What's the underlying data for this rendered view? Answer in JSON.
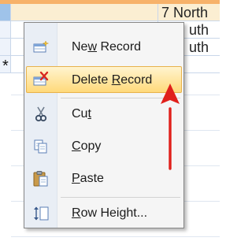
{
  "datasheet": {
    "row1_text": "7 North",
    "row2_text": "uth",
    "row3_text": "uth",
    "new_row_marker": "*"
  },
  "context_menu": {
    "items": [
      {
        "pre": "Ne",
        "key": "w",
        "post": " Record",
        "icon": "new-record-icon"
      },
      {
        "pre": "Delete ",
        "key": "R",
        "post": "ecord",
        "icon": "delete-record-icon",
        "highlighted": true
      },
      {
        "pre": "Cu",
        "key": "t",
        "post": "",
        "icon": "cut-icon"
      },
      {
        "pre": "",
        "key": "C",
        "post": "opy",
        "icon": "copy-icon"
      },
      {
        "pre": "",
        "key": "P",
        "post": "aste",
        "icon": "paste-icon"
      },
      {
        "pre": "",
        "key": "R",
        "post": "ow Height...",
        "icon": "row-height-icon"
      }
    ]
  },
  "annotation": {
    "arrow_color": "#e0201b"
  }
}
